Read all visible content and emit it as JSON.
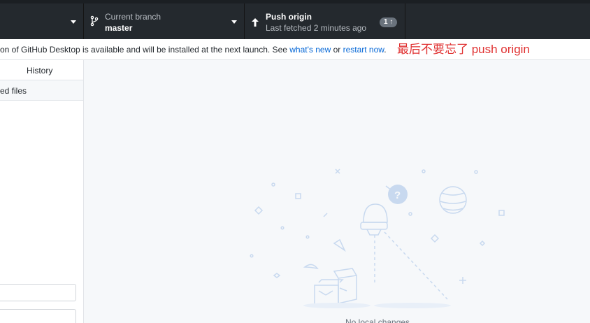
{
  "toolbar": {
    "branch": {
      "title": "Current branch",
      "name": "master"
    },
    "push": {
      "title": "Push origin",
      "subtitle": "Last fetched 2 minutes ago",
      "badge": "1 ↑"
    }
  },
  "banner": {
    "message": "on of GitHub Desktop is available and will be installed at the next launch. See ",
    "link_whats_new": "what's new",
    "or_text": " or ",
    "link_restart": "restart now",
    "end_text": "."
  },
  "annotation": "最后不要忘了 push origin",
  "sidebar": {
    "tab_history": "History",
    "changed_files": "ed files"
  },
  "main": {
    "empty_label": "No local changes"
  },
  "colors": {
    "toolbar_bg": "#24292e",
    "link": "#0366d6",
    "annotation": "#e03131",
    "illustration": "#c8d9ef"
  }
}
